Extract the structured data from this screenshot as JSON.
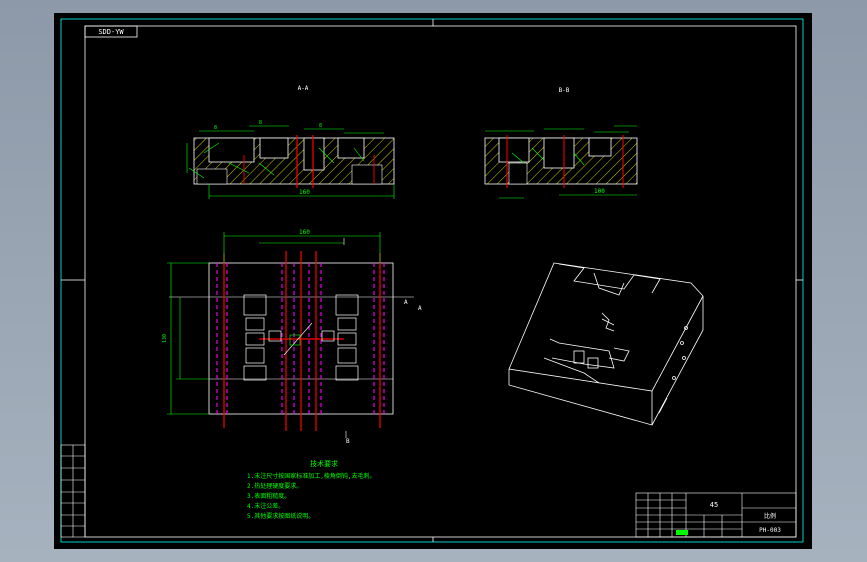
{
  "drawing_code_tag": "SDD-YW",
  "views": {
    "section_a_label": "A-A",
    "section_b_label": "B-B",
    "plan_section_marker": "A",
    "plan_side_marker": "A",
    "plan_bottom_marker": "B"
  },
  "tech_requirements": {
    "title": "技术要求",
    "lines": [
      "1.未注尺寸按国家标准加工,棱角倒钝,去毛刺。",
      "2.热处理硬度要求。",
      "3.表面粗糙度。",
      "4.未注公差。",
      "5.其他要求按图纸说明。"
    ]
  },
  "title_block": {
    "material": "45",
    "drawing_number": "PH-003",
    "scale_label": "比例"
  },
  "colors": {
    "frame": "#00ffff",
    "geometry": "#ffffff",
    "dimension": "#00ff00",
    "hatch": "#ffff00",
    "centerline": "#ff0000",
    "hidden": "#ff00ff"
  }
}
